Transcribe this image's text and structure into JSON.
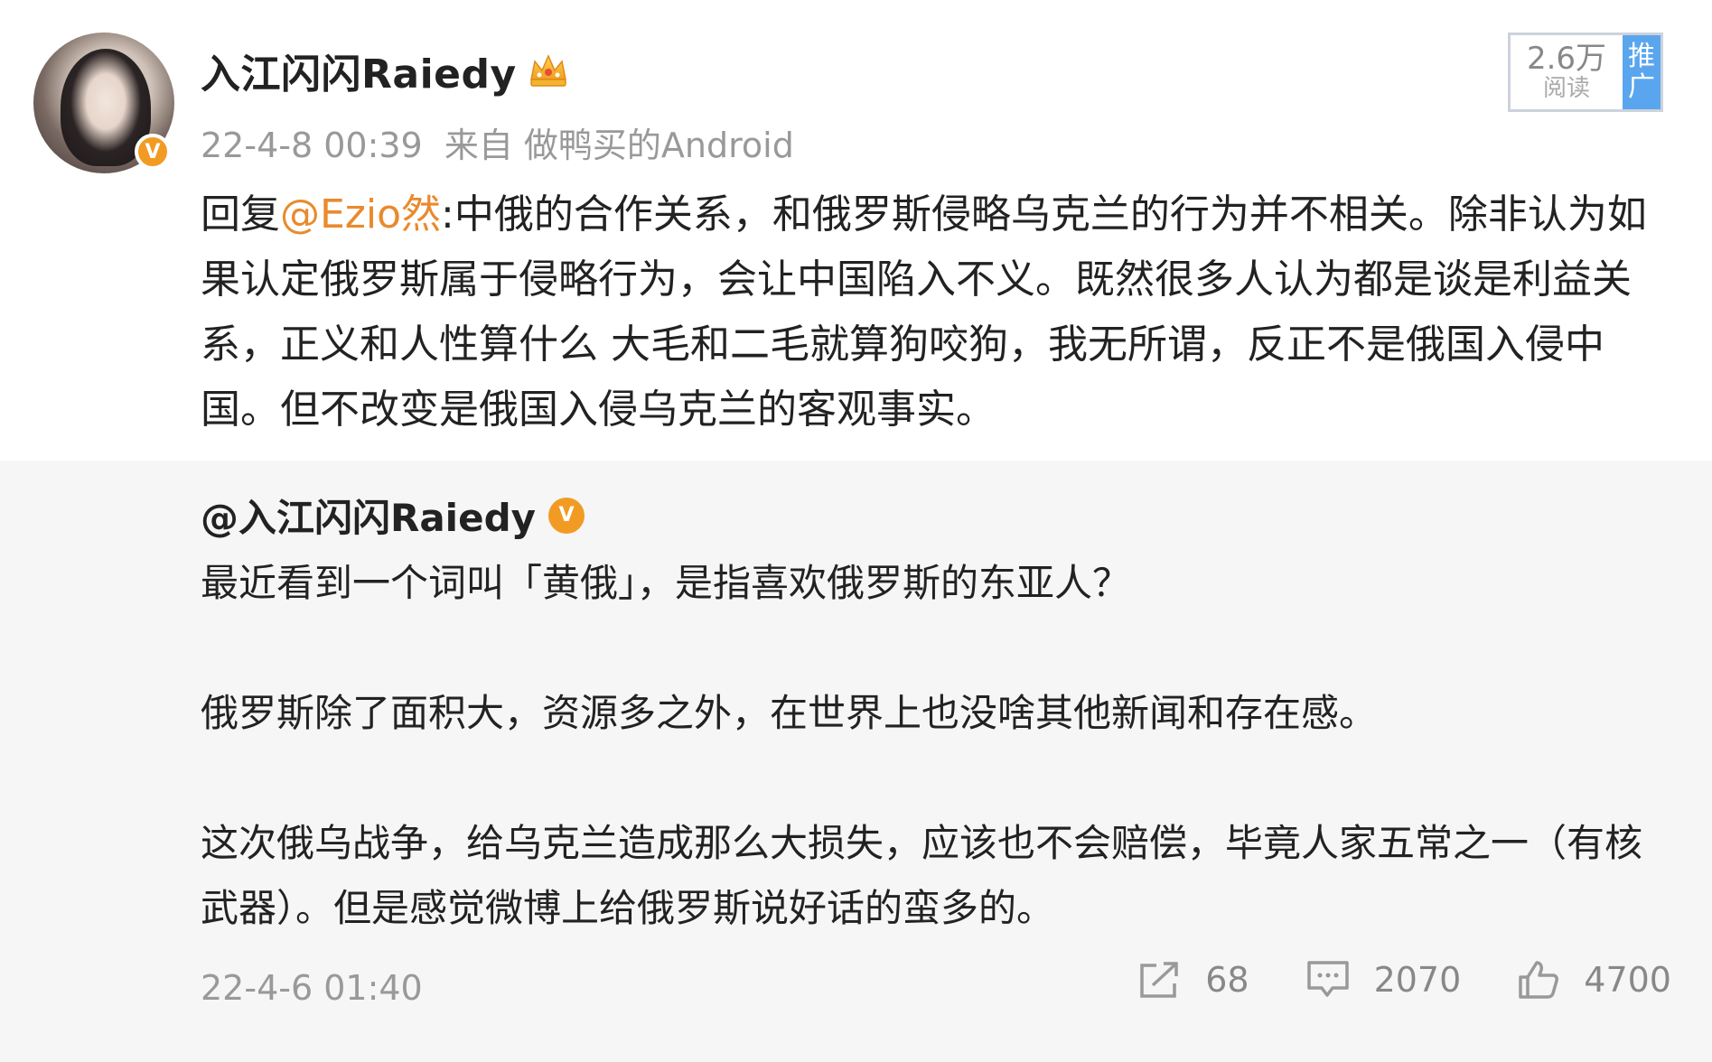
{
  "post": {
    "author": "入江闪闪Raiedy",
    "date": "22-4-8 00:39",
    "source": "来自 做鸭买的Android",
    "reads": "2.6万",
    "reads_label": "阅读",
    "promo_label_1": "推",
    "promo_label_2": "广",
    "reply_prefix": "回复",
    "reply_mention": "@Ezio然",
    "reply_body": ":中俄的合作关系，和俄罗斯侵略乌克兰的行为并不相关。除非认为如果认定俄罗斯属于侵略行为，会让中国陷入不义。既然很多人认为都是谈是利益关系，正义和人性算什么    大毛和二毛就算狗咬狗，我无所谓，反正不是俄国入侵中国。但不改变是俄国入侵乌克兰的客观事实。"
  },
  "quoted": {
    "author": "@入江闪闪Raiedy",
    "paragraphs": [
      "最近看到一个词叫「黄俄」，是指喜欢俄罗斯的东亚人？",
      "俄罗斯除了面积大，资源多之外，在世界上也没啥其他新闻和存在感。",
      "这次俄乌战争，给乌克兰造成那么大损失，应该也不会赔偿，毕竟人家五常之一（有核武器）。但是感觉微博上给俄罗斯说好话的蛮多的。"
    ],
    "date": "22-4-6 01:40",
    "reposts": "68",
    "comments": "2070",
    "likes": "4700"
  },
  "icons": {
    "verify": "v-badge-icon",
    "crown": "crown-icon",
    "repost": "repost-icon",
    "comment": "comment-icon",
    "like": "thumbs-up-icon"
  },
  "colors": {
    "mention": "#e98a2e",
    "verify": "#f29b24",
    "promo": "#5aa6ee",
    "quote_bg": "#f6f6f6"
  }
}
